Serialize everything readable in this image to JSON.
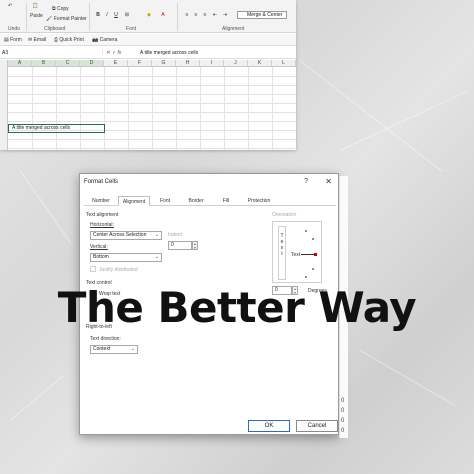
{
  "ribbon": {
    "copy": "Copy",
    "paste": "Paste",
    "format_painter": "Format Painter",
    "undo": "Undo",
    "clipboard": "Clipboard",
    "font": "Font",
    "alignment": "Alignment",
    "bold": "B",
    "italic": "I",
    "underline": "U",
    "merge_center": "Merge & Center"
  },
  "quickbar": {
    "form": "Form",
    "email": "Email",
    "quick_print": "Quick Print",
    "camera": "Camera"
  },
  "formula_bar": {
    "name_box": "A3",
    "fx": "fx",
    "value": "A title merged across cells"
  },
  "grid": {
    "columns": [
      "A",
      "B",
      "C",
      "D",
      "E",
      "F",
      "G",
      "H",
      "I",
      "J",
      "K",
      "L"
    ],
    "cell_text": "A title merged across cells"
  },
  "dialog": {
    "title": "Format Cells",
    "help": "?",
    "close": "✕",
    "tabs": [
      "Number",
      "Alignment",
      "Font",
      "Border",
      "Fill",
      "Protection"
    ],
    "text_alignment": "Text alignment",
    "horizontal_label": "Horizontal:",
    "horizontal_value": "Center Across Selection",
    "indent_label": "Indent:",
    "indent_value": "0",
    "vertical_label": "Vertical:",
    "vertical_value": "Bottom",
    "justify_distributed": "Justify distributed",
    "text_control": "Text control",
    "wrap_text": "Wrap text",
    "right_to_left": "Right-to-left",
    "text_direction_label": "Text direction:",
    "text_direction_value": "Context",
    "orientation": "Orientation",
    "vertical_text": "T e x t",
    "dial_text": "Text",
    "degrees_value": "0",
    "degrees_label": "Degrees",
    "ok": "OK",
    "cancel": "Cancel"
  },
  "side_numbers": [
    "0",
    "0",
    "0",
    "0"
  ],
  "overlay": {
    "headline": "The Better Way"
  }
}
